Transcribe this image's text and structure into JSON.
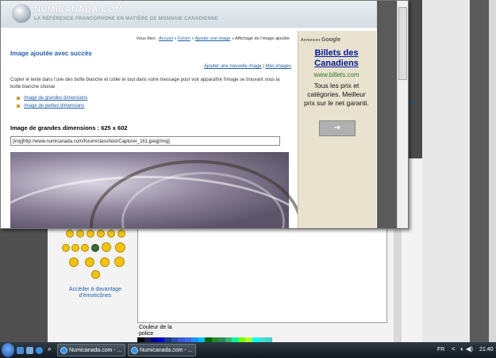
{
  "site": {
    "name": "NUMICANADA.COM",
    "tagline": "LA RÉFÉRENCE FRANCOPHONE EN MATIÈRE DE MONNAIE CANADIENNE"
  },
  "breadcrumb": {
    "prefix": "Vous êtes :",
    "items": [
      "Accueil",
      "Forum",
      "Ajouter une image"
    ],
    "current": "Affichage de l'image ajoutée",
    "sep": "»"
  },
  "page": {
    "title": "Image ajoutée avec succès",
    "link_add": "Ajouter une nouvelle image",
    "link_sep": "|",
    "link_my": "Mes images",
    "instructions": "Copier le texte dans l'une des boîte blanche et coller le tout dans votre message pour voir apparaître l'image se trouvant sous la boîte blanche choisie",
    "options": [
      "Image de grandes dimensions",
      "Image de petites dimensions"
    ],
    "section_title": "Image de grandes dimensions : 625 x 602",
    "code_value": "[img]http://www.numicanada.com/forum/class/test/Capturer_161.jpeg[/img]"
  },
  "ad": {
    "label_prefix": "Annonces",
    "label_brand": "Google",
    "title": "Billets des Canadiens",
    "url": "www.billets.com",
    "body": "Tous les prix et catégories. Meilleur prix sur le net garanti.",
    "button": "➔"
  },
  "background_page": {
    "forum_link": "orum",
    "more_emoticons": "Accéder à davantage d'émoticônes",
    "font_color_label": "Couleur de la police",
    "palette": [
      "#000000",
      "#1a1a4d",
      "#00008b",
      "#0000cd",
      "#1e3a8a",
      "#2f4fa8",
      "#3b5bdb",
      "#4169e1",
      "#1e90ff",
      "#00bfff",
      "#006400",
      "#228b22",
      "#2e8b57",
      "#3cb371",
      "#00fa9a",
      "#7cfc00",
      "#adff2f",
      "#00ffff",
      "#40e0d0",
      "#48d1cc"
    ]
  },
  "taskbar": {
    "tasks": [
      "Numicanada.com - ...",
      "Numicanada.com - ..."
    ],
    "chevron": "»",
    "language": "FR",
    "tray_arrow": "<",
    "tray_icons": "◐ ◀)",
    "clock": "21:40"
  },
  "colors": {
    "link": "#1f5ea8",
    "ad_title": "#001a99",
    "ad_url": "#2b7a2b",
    "ad_bg": "#e8e2cf"
  }
}
